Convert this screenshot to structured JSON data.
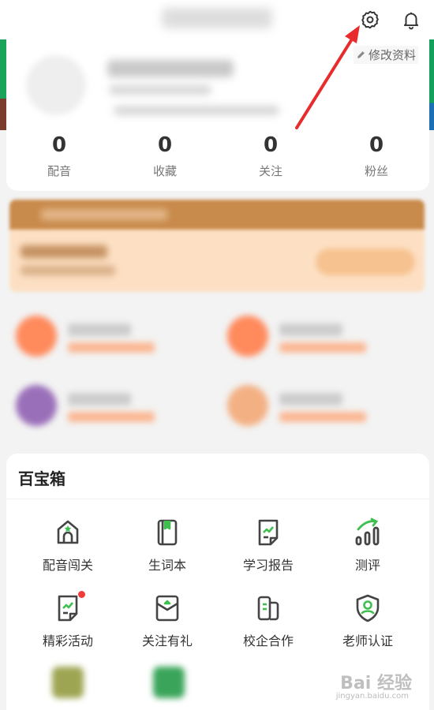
{
  "header": {
    "settings_icon": "gear-icon",
    "notification_icon": "bell-icon"
  },
  "profile": {
    "edit_label": "修改资料",
    "stats": [
      {
        "value": "0",
        "label": "配音"
      },
      {
        "value": "0",
        "label": "收藏"
      },
      {
        "value": "0",
        "label": "关注"
      },
      {
        "value": "0",
        "label": "粉丝"
      }
    ]
  },
  "toolbox": {
    "title": "百宝箱",
    "items": [
      {
        "label": "配音闯关",
        "icon": "house-star-icon"
      },
      {
        "label": "生词本",
        "icon": "notebook-icon"
      },
      {
        "label": "学习报告",
        "icon": "report-icon"
      },
      {
        "label": "测评",
        "icon": "bar-chart-icon"
      },
      {
        "label": "精彩活动",
        "icon": "activity-icon"
      },
      {
        "label": "关注有礼",
        "icon": "gift-envelope-icon"
      },
      {
        "label": "校企合作",
        "icon": "cooperation-icon"
      },
      {
        "label": "老师认证",
        "icon": "teacher-badge-icon"
      }
    ]
  },
  "colors": {
    "accent_green": "#3fbf4f",
    "icon_gray": "#444444",
    "badge_red": "#f23c3c",
    "annotation_arrow": "#e82b2b"
  }
}
